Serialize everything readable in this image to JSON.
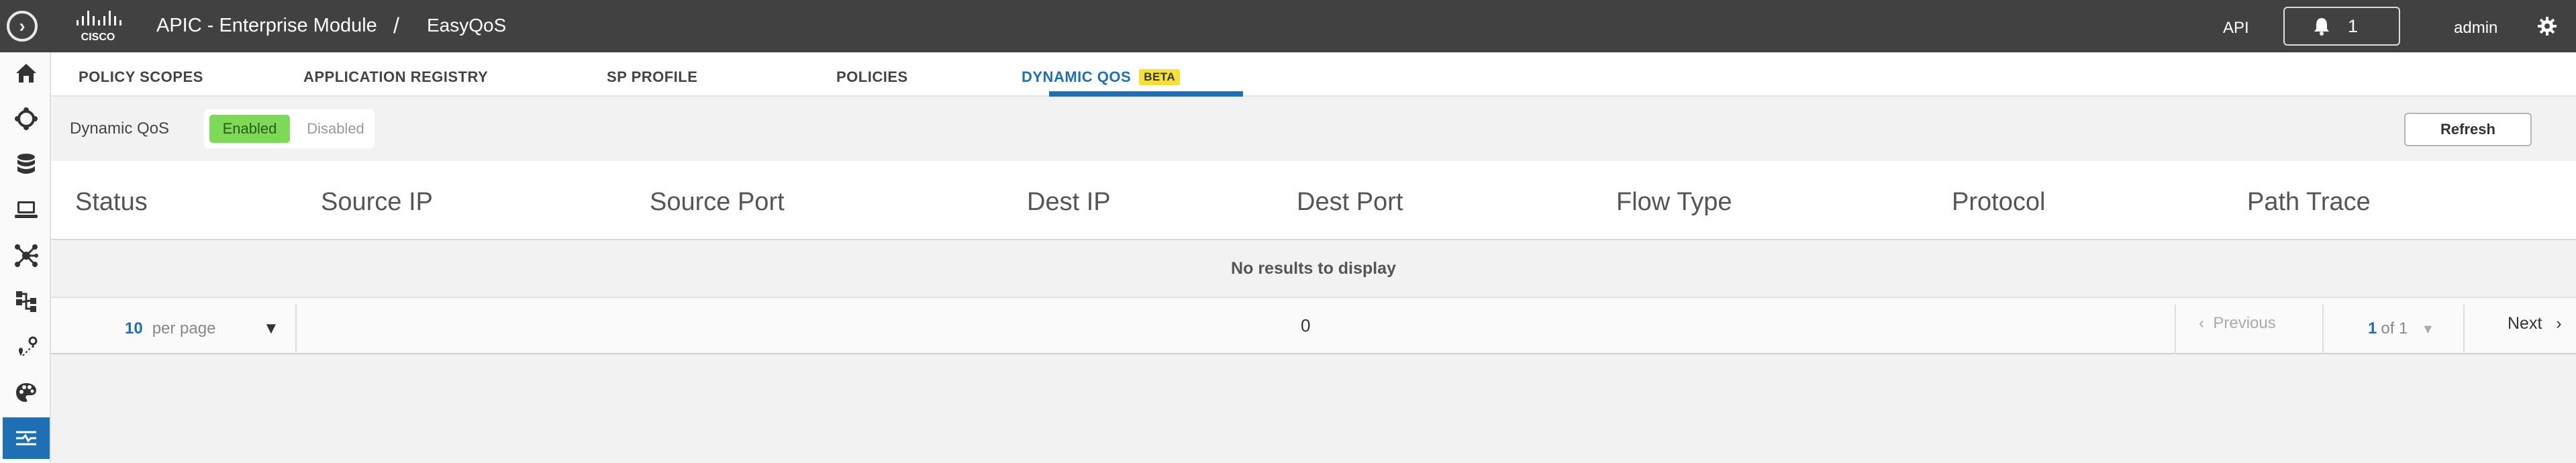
{
  "header": {
    "app_title": "APIC - Enterprise Module",
    "breadcrumb_separator": "/",
    "breadcrumb": "EasyQoS",
    "api_label": "API",
    "notification_count": "1",
    "user": "admin"
  },
  "sidebar": {
    "items": [
      "home-icon",
      "policy-icon",
      "database-icon",
      "device-icon",
      "topology-icon",
      "flow-icon",
      "path-icon",
      "palette-icon",
      "settings-sliders-icon"
    ],
    "active_index": 8
  },
  "tabs": [
    {
      "label": "POLICY SCOPES"
    },
    {
      "label": "APPLICATION REGISTRY"
    },
    {
      "label": "SP PROFILE"
    },
    {
      "label": "POLICIES"
    },
    {
      "label": "DYNAMIC QOS",
      "badge": "BETA",
      "active": true
    }
  ],
  "filter": {
    "label": "Dynamic QoS",
    "enabled": "Enabled",
    "disabled": "Disabled",
    "selected": "Enabled",
    "refresh": "Refresh"
  },
  "table": {
    "columns": [
      "Status",
      "Source IP",
      "Source Port",
      "Dest IP",
      "Dest Port",
      "Flow Type",
      "Protocol",
      "Path Trace"
    ],
    "empty_message": "No results to display"
  },
  "pagination": {
    "per_page_value": "10",
    "per_page_label": "per page",
    "total": "0",
    "previous": "Previous",
    "current_page": "1",
    "of_pages": "of 1",
    "next": "Next"
  },
  "colors": {
    "topbar": "#414141",
    "accent": "#1f6fb4",
    "enabled": "#7ed957",
    "beta": "#f6e038"
  }
}
